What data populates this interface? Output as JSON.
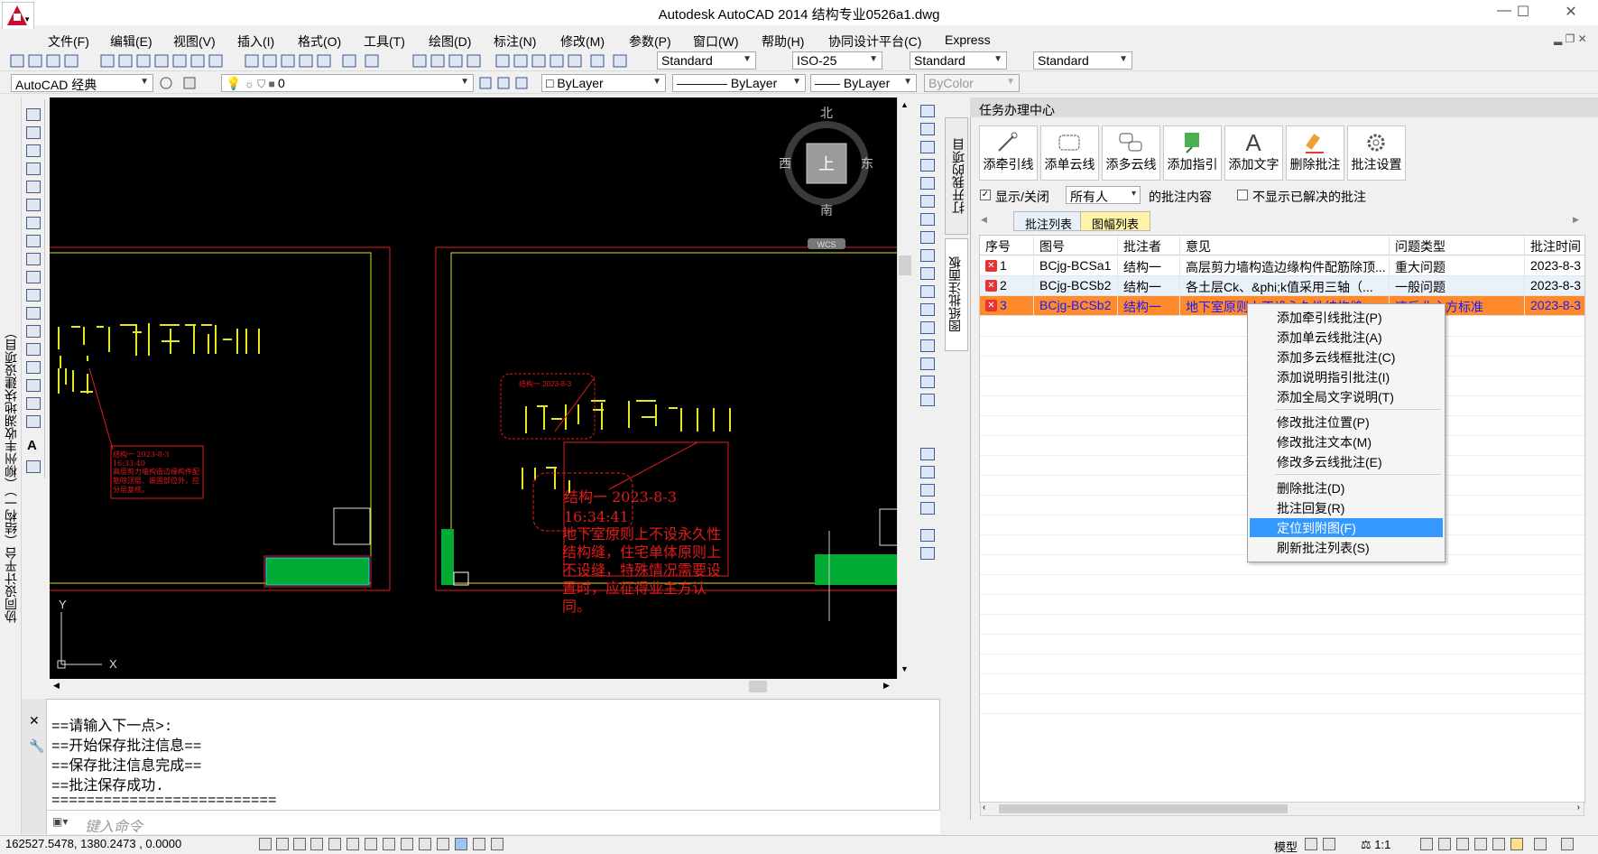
{
  "window": {
    "title": "Autodesk AutoCAD 2014    结构专业0526a1.dwg",
    "controls": [
      "—",
      "☐",
      "✕"
    ]
  },
  "menu": [
    "文件(F)",
    "编辑(E)",
    "视图(V)",
    "插入(I)",
    "格式(O)",
    "工具(T)",
    "绘图(D)",
    "标注(N)",
    "修改(M)",
    "参数(P)",
    "窗口(W)",
    "帮助(H)",
    "协同设计平台(C)",
    "Express"
  ],
  "toolbar1": {
    "text_style": "Standard",
    "dim_style": "ISO-25",
    "table_style": "Standard",
    "multileader_style": "Standard"
  },
  "toolbar2": {
    "workspace": "AutoCAD 经典",
    "layer": "0",
    "color": "ByLayer",
    "linetype": "ByLayer",
    "lineweight": "ByLayer",
    "plotstyle": "ByColor"
  },
  "side_vertical_text": "协同设计平台（结构一）（柳州丰收湖地块建设项目）",
  "viewcube": {
    "north": "北",
    "south": "南",
    "east": "东",
    "west": "西",
    "top": "上",
    "wcs": "WCS"
  },
  "ucs": {
    "y": "Y",
    "x": "X"
  },
  "drawing_annotations": {
    "left_note_header": "结构一 2023-8-3",
    "left_note_time": "16:33:40",
    "left_note_body": "高层剪力墙构造边缘构件配筋除顶层、嵌固部位外，应分层复核。",
    "center_note_header": "结构一 2023-8-3",
    "center_note_time": "16:34:41",
    "center_note_body": "地下室原则上不设永久性结构缝，住宅单体原则上不设缝，特殊情况需要设置时，应征得业主方认同。",
    "small_note_header": "结构一 2023-8-3"
  },
  "panel": {
    "title": "任务办理中心",
    "vertical_tabs": [
      "打开我的项目",
      "图纸批注面板"
    ],
    "buttons": [
      "添牵引线",
      "添单云线",
      "添多云线",
      "添加指引",
      "添加文字",
      "删除批注",
      "批注设置"
    ],
    "filter": {
      "show_toggle": "显示/关闭",
      "owner": "所有人",
      "owner_suffix": "的批注内容",
      "hide_resolved": "不显示已解决的批注"
    },
    "tabs": [
      "批注列表",
      "图幅列表"
    ],
    "columns": [
      "序号",
      "图号",
      "批注者",
      "意见",
      "问题类型",
      "批注时间"
    ],
    "rows": [
      {
        "no": "1",
        "drawing": "BCjg-BCSa1",
        "author": "结构一",
        "opinion": "高层剪力墙构造边缘构件配筋除顶...",
        "type": "重大问题",
        "time": "2023-8-3"
      },
      {
        "no": "2",
        "drawing": "BCjg-BCSb2",
        "author": "结构一",
        "opinion": "各土层Ck、&phi;k值采用三轴（...",
        "type": "一般问题",
        "time": "2023-8-3"
      },
      {
        "no": "3",
        "drawing": "BCjg-BCSb2",
        "author": "结构一",
        "opinion": "地下室原则上不设永久性结构缝",
        "type": "违反业主方标准",
        "time": "2023-8-3"
      }
    ]
  },
  "context_menu": [
    "添加牵引线批注(P)",
    "添加单云线批注(A)",
    "添加多云线框批注(C)",
    "添加说明指引批注(I)",
    "添加全局文字说明(T)",
    "修改批注位置(P)",
    "修改批注文本(M)",
    "修改多云线批注(E)",
    "删除批注(D)",
    "批注回复(R)",
    "定位到附图(F)",
    "刷新批注列表(S)"
  ],
  "command_history": [
    "==请输入下一点>:",
    "==开始保存批注信息==",
    "==保存批注信息完成==",
    "==批注保存成功.",
    "=========================="
  ],
  "command_placeholder": "键入命令",
  "status": {
    "coords": "162527.5478, 1380.2473  , 0.0000",
    "model": "模型",
    "scale": "1:1"
  }
}
